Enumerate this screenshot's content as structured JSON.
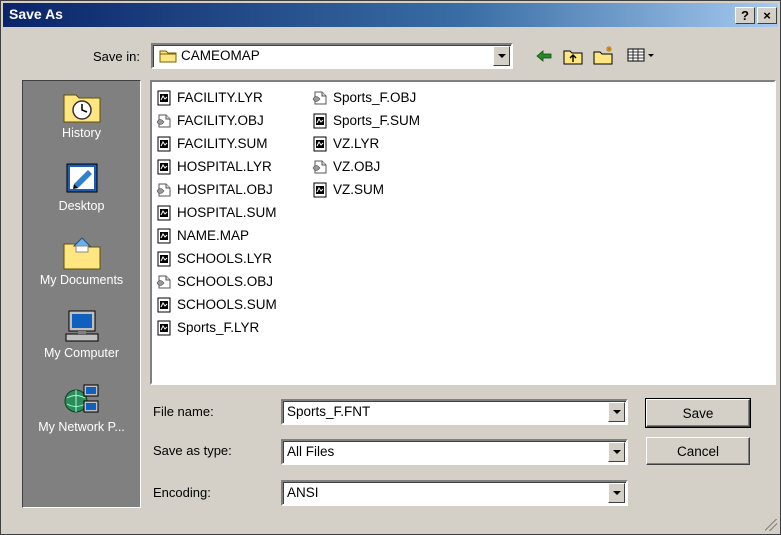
{
  "window": {
    "title": "Save As",
    "help_label": "?",
    "close_label": "×"
  },
  "toolbar": {
    "save_in_label": "Save in:",
    "folder": "CAMEOMAP"
  },
  "places": [
    {
      "label": "History",
      "icon": "history-icon"
    },
    {
      "label": "Desktop",
      "icon": "desktop-icon"
    },
    {
      "label": "My Documents",
      "icon": "my-documents-icon"
    },
    {
      "label": "My Computer",
      "icon": "my-computer-icon"
    },
    {
      "label": "My Network P...",
      "icon": "network-places-icon"
    }
  ],
  "files": {
    "column1": [
      {
        "name": "FACILITY.LYR",
        "type": "doc"
      },
      {
        "name": "FACILITY.OBJ",
        "type": "obj"
      },
      {
        "name": "FACILITY.SUM",
        "type": "doc"
      },
      {
        "name": "HOSPITAL.LYR",
        "type": "doc"
      },
      {
        "name": "HOSPITAL.OBJ",
        "type": "obj"
      },
      {
        "name": "HOSPITAL.SUM",
        "type": "doc"
      },
      {
        "name": "NAME.MAP",
        "type": "doc"
      },
      {
        "name": "SCHOOLS.LYR",
        "type": "doc"
      },
      {
        "name": "SCHOOLS.OBJ",
        "type": "obj"
      },
      {
        "name": "SCHOOLS.SUM",
        "type": "doc"
      },
      {
        "name": "Sports_F.LYR",
        "type": "doc"
      }
    ],
    "column2": [
      {
        "name": "Sports_F.OBJ",
        "type": "obj"
      },
      {
        "name": "Sports_F.SUM",
        "type": "doc"
      },
      {
        "name": "VZ.LYR",
        "type": "doc"
      },
      {
        "name": "VZ.OBJ",
        "type": "obj"
      },
      {
        "name": "VZ.SUM",
        "type": "doc"
      }
    ]
  },
  "form": {
    "file_name_label": "File name:",
    "file_name_value": "Sports_F.FNT",
    "save_type_label": "Save as type:",
    "save_type_value": "All Files",
    "encoding_label": "Encoding:",
    "encoding_value": "ANSI"
  },
  "buttons": {
    "save": "Save",
    "cancel": "Cancel"
  }
}
